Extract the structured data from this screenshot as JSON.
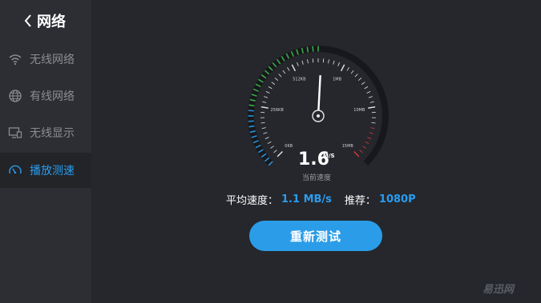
{
  "header": {
    "title": "网络"
  },
  "sidebar": {
    "items": [
      {
        "label": "无线网络",
        "icon": "wifi-icon",
        "active": false
      },
      {
        "label": "有线网络",
        "icon": "globe-icon",
        "active": false
      },
      {
        "label": "无线显示",
        "icon": "display-icon",
        "active": false
      },
      {
        "label": "播放测速",
        "icon": "speedometer-icon",
        "active": true
      }
    ]
  },
  "gauge": {
    "tick_labels": [
      "0KB",
      "256KB",
      "512KB",
      "1MB",
      "10MB",
      "15MB"
    ],
    "speed_value": "1.6",
    "speed_unit": "M/S",
    "caption": "当前速度"
  },
  "summary": {
    "avg_label": "平均速度：",
    "avg_value": "1.1 MB/s",
    "rec_label": "推荐：",
    "rec_value": "1080P"
  },
  "actions": {
    "retest_label": "重新测试"
  },
  "watermark": "易迅网",
  "colors": {
    "accent": "#2b9de8",
    "sidebar_bg": "#2c2e33",
    "main_bg": "#25272c",
    "gauge_green": "#3aa84a",
    "gauge_red": "#d83a3a"
  }
}
